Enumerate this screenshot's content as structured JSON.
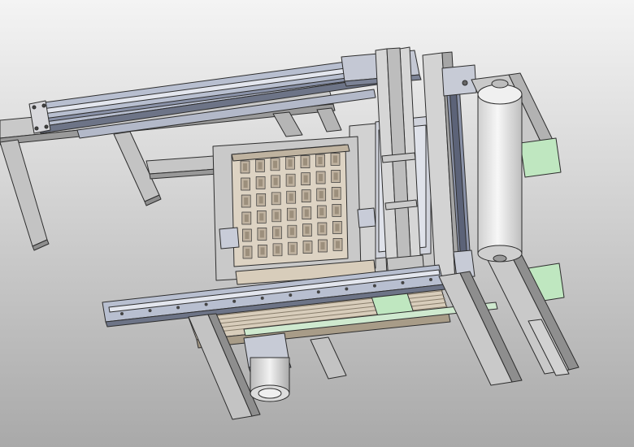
{
  "scene": {
    "subject": "cad-assembly-render",
    "colors": {
      "bg_top": "#f4f4f4",
      "bg_bottom": "#a9a9a9",
      "frame": "#c9c9c9",
      "frame_dark": "#8e8e8e",
      "rail": "#b8bfd0",
      "rail_dark": "#6d7487",
      "tray": "#ddd3c3",
      "tray_dark": "#a89c88",
      "green": "#bfe7c0",
      "roller": "#eaeaea",
      "edge": "#2e2e2e"
    }
  }
}
